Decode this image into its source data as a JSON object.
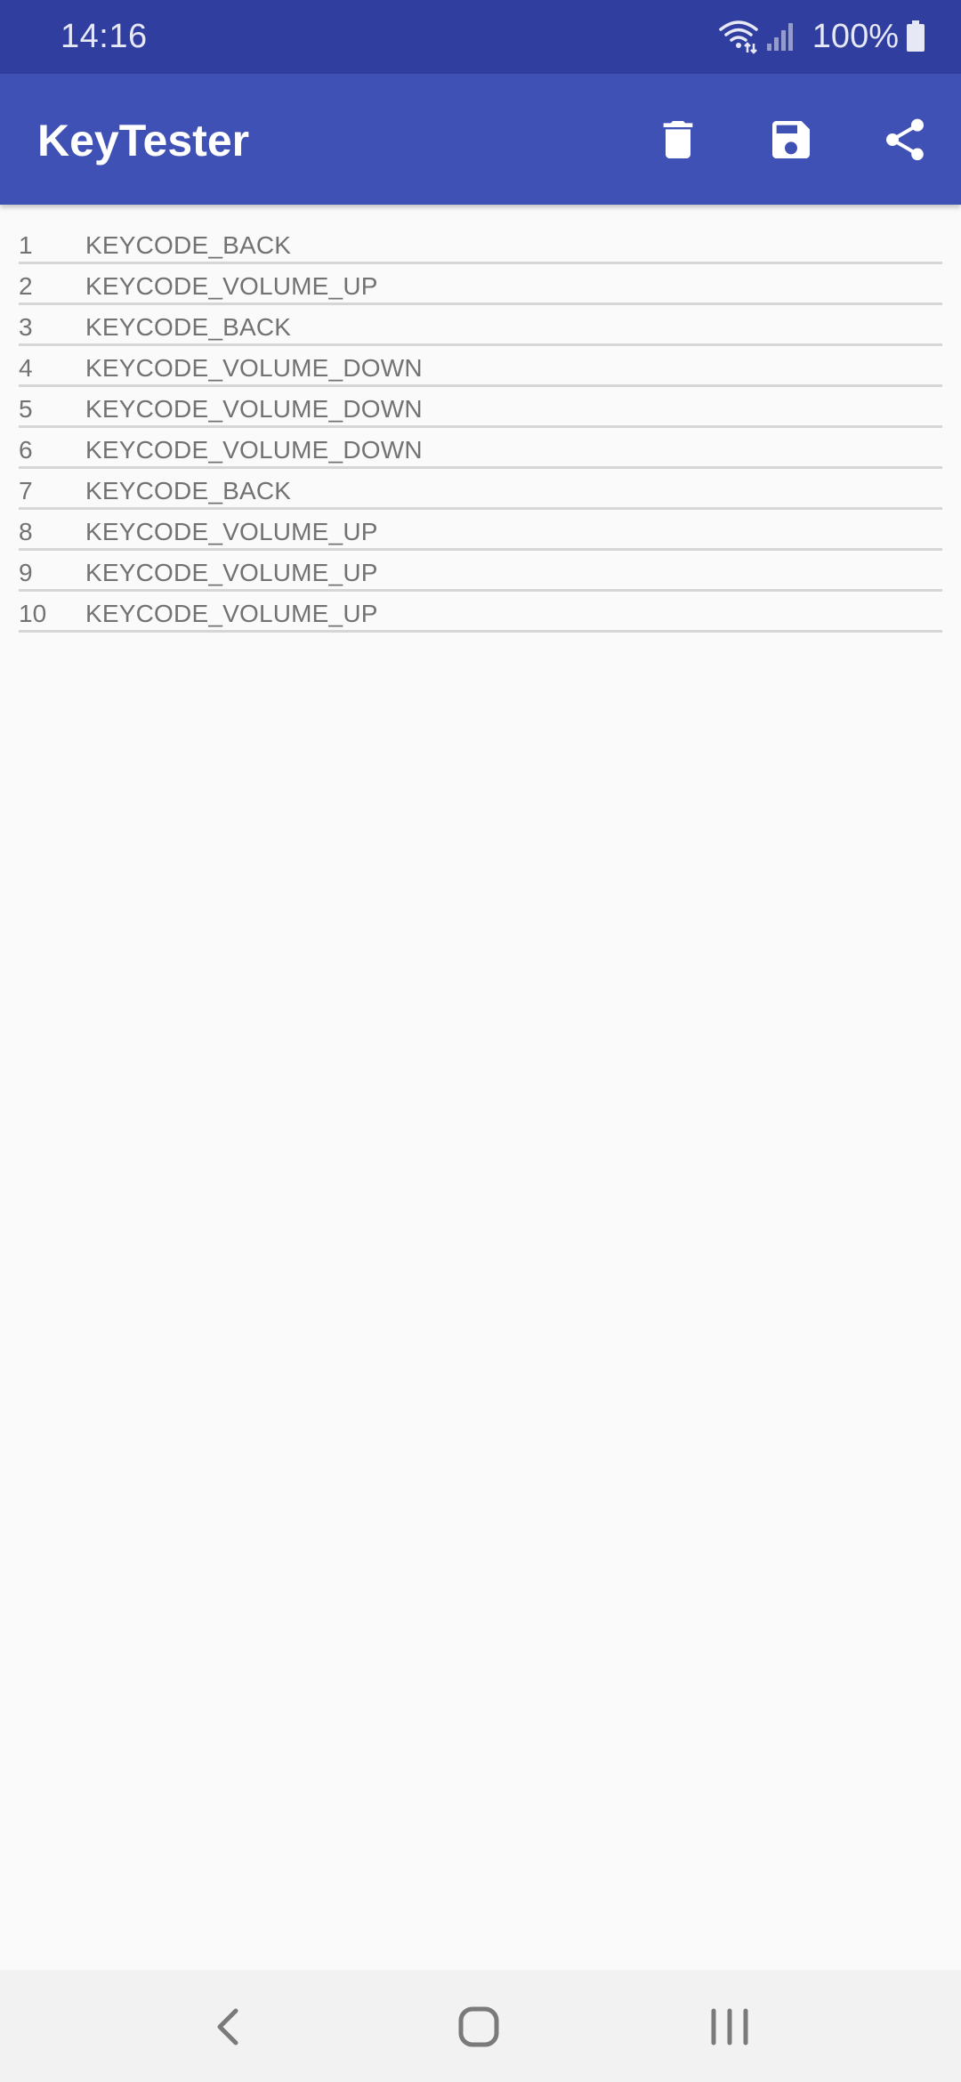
{
  "status_bar": {
    "time": "14:16",
    "battery": "100%",
    "icons": [
      "wifi-icon",
      "signal-icon",
      "battery-icon"
    ]
  },
  "app_bar": {
    "title": "KeyTester",
    "actions": [
      {
        "name": "delete",
        "icon": "trash-icon"
      },
      {
        "name": "save",
        "icon": "floppy-disk-icon"
      },
      {
        "name": "share",
        "icon": "share-icon"
      }
    ]
  },
  "key_events": [
    {
      "index": "1",
      "keycode": "KEYCODE_BACK"
    },
    {
      "index": "2",
      "keycode": "KEYCODE_VOLUME_UP"
    },
    {
      "index": "3",
      "keycode": "KEYCODE_BACK"
    },
    {
      "index": "4",
      "keycode": "KEYCODE_VOLUME_DOWN"
    },
    {
      "index": "5",
      "keycode": "KEYCODE_VOLUME_DOWN"
    },
    {
      "index": "6",
      "keycode": "KEYCODE_VOLUME_DOWN"
    },
    {
      "index": "7",
      "keycode": "KEYCODE_BACK"
    },
    {
      "index": "8",
      "keycode": "KEYCODE_VOLUME_UP"
    },
    {
      "index": "9",
      "keycode": "KEYCODE_VOLUME_UP"
    },
    {
      "index": "10",
      "keycode": "KEYCODE_VOLUME_UP"
    }
  ],
  "nav_bar": {
    "icons": [
      "back-icon",
      "home-icon",
      "recents-icon"
    ]
  },
  "colors": {
    "status_bar": "#303f9f",
    "app_bar": "#3f51b5",
    "background": "#fafafa",
    "row_text": "#727272",
    "divider": "#d6d6d6",
    "nav_bar": "#f2f2f2"
  }
}
